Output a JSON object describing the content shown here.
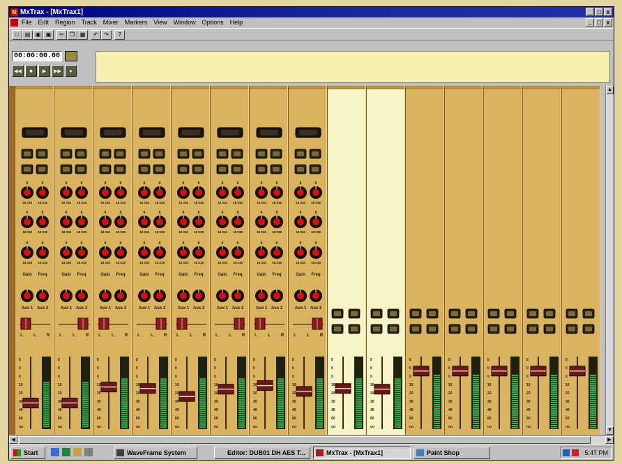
{
  "window": {
    "title": "MxTrax - [MxTrax1]",
    "controls": {
      "minimize": "_",
      "maximize": "□",
      "close": "x"
    }
  },
  "menu": {
    "items": [
      "File",
      "Edit",
      "Region",
      "Track",
      "Mixer",
      "Markers",
      "View",
      "Window",
      "Options",
      "Help"
    ]
  },
  "toolbar": {
    "buttons": [
      {
        "name": "new-icon",
        "glyph": "□"
      },
      {
        "name": "open-icon",
        "glyph": "▤"
      },
      {
        "name": "save-icon",
        "glyph": "▣"
      },
      {
        "name": "save-all-icon",
        "glyph": "▣"
      },
      {
        "name": "cut-icon",
        "glyph": "✂"
      },
      {
        "name": "copy-icon",
        "glyph": "❐"
      },
      {
        "name": "paste-icon",
        "glyph": "▦"
      },
      {
        "name": "undo-icon",
        "glyph": "↶"
      },
      {
        "name": "redo-icon",
        "glyph": "↷"
      },
      {
        "name": "help-icon",
        "glyph": "?"
      }
    ]
  },
  "transport": {
    "timecode": "00:00:00.00",
    "buttons": [
      {
        "name": "rewind-icon",
        "glyph": "◀◀"
      },
      {
        "name": "stop-icon",
        "glyph": "■"
      },
      {
        "name": "play-icon",
        "glyph": "▶"
      },
      {
        "name": "fast-forward-icon",
        "glyph": "▶▶"
      },
      {
        "name": "record-icon",
        "glyph": "●"
      }
    ]
  },
  "mixer": {
    "strip_count": 15,
    "full_strips": 8,
    "labels": {
      "eq_gain": "Gain",
      "eq_freq": "Freq",
      "aux1": "Aux 1",
      "aux2": "Aux 2",
      "pan_left": "L",
      "pan_right": "R",
      "knob_ticks": "18 018",
      "knob_top": "6",
      "fader_scale": [
        "5",
        "0",
        "5",
        "10",
        "20",
        "30",
        "40",
        "60",
        "oo"
      ]
    },
    "strips": [
      {
        "type": "full",
        "fader": 0.36,
        "meter": 0.65
      },
      {
        "type": "full",
        "fader": 0.36,
        "meter": 0.65
      },
      {
        "type": "full",
        "fader": 0.58,
        "meter": 0.7
      },
      {
        "type": "full",
        "fader": 0.56,
        "meter": 0.7
      },
      {
        "type": "full",
        "fader": 0.45,
        "meter": 0.7
      },
      {
        "type": "full",
        "fader": 0.55,
        "meter": 0.7
      },
      {
        "type": "full",
        "fader": 0.6,
        "meter": 0.7
      },
      {
        "type": "full",
        "fader": 0.52,
        "meter": 0.7
      },
      {
        "type": "master-light",
        "fader": 0.56,
        "meter": 0.7
      },
      {
        "type": "master-light",
        "fader": 0.55,
        "meter": 0.7
      },
      {
        "type": "simple",
        "fader": 0.8,
        "meter": 0.75
      },
      {
        "type": "simple",
        "fader": 0.8,
        "meter": 0.75
      },
      {
        "type": "simple",
        "fader": 0.8,
        "meter": 0.75
      },
      {
        "type": "simple",
        "fader": 0.8,
        "meter": 0.75
      },
      {
        "type": "simple",
        "fader": 0.8,
        "meter": 0.75
      }
    ]
  },
  "taskbar": {
    "start": "Start",
    "items": [
      {
        "label": "WaveFrame System",
        "pressed": false
      },
      {
        "label": "Editor: DUB01 DH AES T...",
        "pressed": false
      },
      {
        "label": "MxTrax - [MxTrax1]",
        "pressed": true
      },
      {
        "label": "Paint Shop",
        "pressed": false
      }
    ],
    "clock": "5:47 PM"
  }
}
